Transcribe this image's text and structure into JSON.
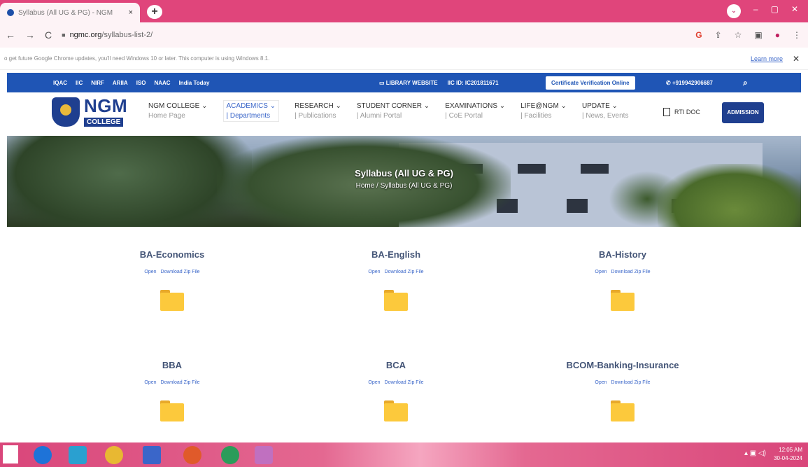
{
  "browser": {
    "tab_title": "Syllabus (All UG & PG) - NGM",
    "tab_close": "×",
    "new_tab": "+",
    "window_controls": [
      "–",
      "▢",
      "✕"
    ],
    "profile_menu": "⌄",
    "url_domain": "ngmc.org",
    "url_path": "/syllabus-list-2/",
    "nav_back": "←",
    "nav_forward": "→",
    "nav_reload": "C",
    "toolbar_icons": [
      "G",
      "⇪",
      "☆",
      "▣",
      "●",
      "⋮"
    ]
  },
  "infobar": {
    "message": "o get future Google Chrome updates, you'll need Windows 10 or later. This computer is using Windows 8.1.",
    "learn_more": "Learn more",
    "close": "✕"
  },
  "site_top": {
    "links": [
      "IQAC",
      "IIC",
      "NIRF",
      "ARIIA",
      "ISO",
      "NAAC",
      "India Today"
    ],
    "library_icon": "▭",
    "library": "LIBRARY WEBSITE",
    "iic_id": "IIC ID: IC201811671",
    "verification": "Certificate Verification Online",
    "phone_icon": "✆",
    "phone": "+919942906687",
    "search_icon": "⌕"
  },
  "logo": {
    "name": "NGM",
    "sub": "COLLEGE"
  },
  "menu": [
    {
      "title": "NGM COLLEGE ⌄",
      "sub": "Home Page"
    },
    {
      "title": "ACADEMICS ⌄",
      "sub": "| Departments"
    },
    {
      "title": "RESEARCH ⌄",
      "sub": "| Publications"
    },
    {
      "title": "STUDENT CORNER ⌄",
      "sub": "| Alumni Portal"
    },
    {
      "title": "EXAMINATIONS ⌄",
      "sub": "| CoE Portal"
    },
    {
      "title": "LIFE@NGM ⌄",
      "sub": "| Facilities"
    },
    {
      "title": "UPDATE ⌄",
      "sub": "| News, Events"
    }
  ],
  "rti": "RTI DOC",
  "admission": "ADMISSION",
  "hero": {
    "title": "Syllabus (All UG & PG)",
    "breadcrumb": "Home / Syllabus (All UG & PG)"
  },
  "syllabus": [
    {
      "name": "BA-Economics",
      "open": "Open",
      "download": "Download Zip File"
    },
    {
      "name": "BA-English",
      "open": "Open",
      "download": "Download Zip File"
    },
    {
      "name": "BA-History",
      "open": "Open",
      "download": "Download Zip File"
    },
    {
      "name": "BBA",
      "open": "Open",
      "download": "Download Zip File"
    },
    {
      "name": "BCA",
      "open": "Open",
      "download": "Download Zip File"
    },
    {
      "name": "BCOM-Banking-Insurance",
      "open": "Open",
      "download": "Download Zip File"
    }
  ],
  "taskbar": {
    "sys_icons": "▴ ▣ ◁)",
    "time": "12:05 AM",
    "date": "30-04-2024",
    "colors": [
      "#1e73d8",
      "#2aa0d0",
      "#e8b832",
      "#3a66c9",
      "#e05a2a",
      "#2b9c5a",
      "#c070c0"
    ]
  }
}
